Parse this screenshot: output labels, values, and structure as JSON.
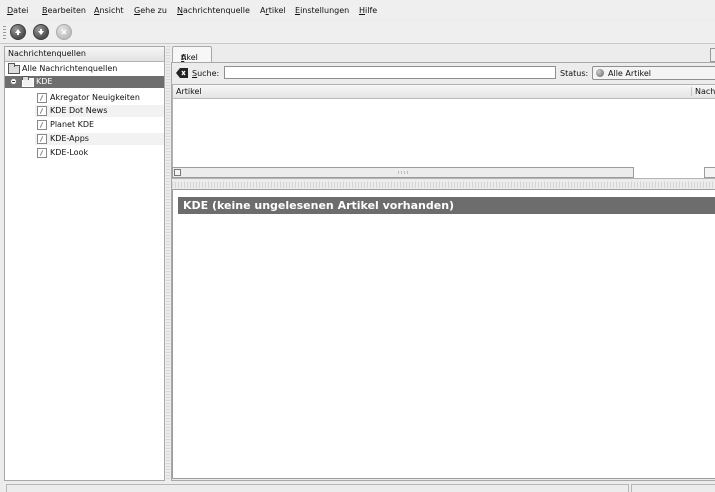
{
  "menubar": {
    "items": [
      {
        "label": "Datei",
        "mnemonic": "D",
        "rest": "atei"
      },
      {
        "label": "Bearbeiten",
        "mnemonic": "B",
        "rest": "earbeiten"
      },
      {
        "label": "Ansicht",
        "mnemonic": "A",
        "rest": "nsicht"
      },
      {
        "label": "Gehe zu",
        "mnemonic": "G",
        "rest": "ehe zu"
      },
      {
        "label": "Nachrichtenquelle",
        "mnemonic": "N",
        "rest": "achrichtenquelle"
      },
      {
        "label": "Artikel",
        "pre": "A",
        "mnemonic": "r",
        "rest": "tikel"
      },
      {
        "label": "Einstellungen",
        "mnemonic": "E",
        "rest": "instellungen"
      },
      {
        "label": "Hilfe",
        "mnemonic": "H",
        "rest": "ilfe"
      }
    ]
  },
  "toolbar": {
    "buttons": [
      {
        "icon": "arrow-up-icon",
        "enabled": true
      },
      {
        "icon": "arrow-down-icon",
        "enabled": true
      },
      {
        "icon": "stop-icon",
        "enabled": false
      }
    ]
  },
  "feeds": {
    "header": "Nachrichtenquellen",
    "all_label": "Alle Nachrichtenquellen",
    "folder": "KDE",
    "items": [
      "Akregator Neuigkeiten",
      "KDE Dot News",
      "Planet KDE",
      "KDE-Apps",
      "KDE-Look"
    ]
  },
  "tab": {
    "pre": "A",
    "mnemonic": "r",
    "rest": "tikel"
  },
  "search": {
    "label_mnemonic": "S",
    "label_rest": "uche:",
    "value": "",
    "status_label": "Status:",
    "status_value": "Alle Artikel"
  },
  "articles": {
    "columns": [
      "Artikel",
      "Nachr"
    ]
  },
  "preview": {
    "title": "KDE (keine ungelesenen Artikel vorhanden)"
  }
}
